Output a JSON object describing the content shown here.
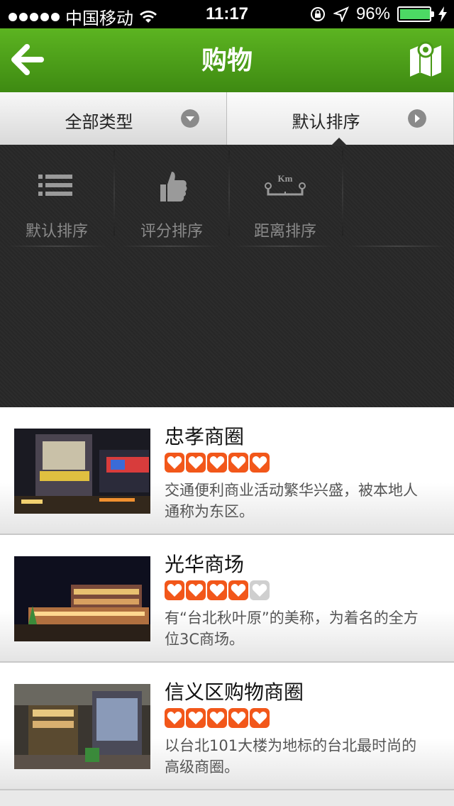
{
  "status_bar": {
    "carrier": "中国移动",
    "time": "11:17",
    "battery": "96%",
    "battery_level": 0.96
  },
  "nav": {
    "title": "购物",
    "back_icon": "arrow-left-icon",
    "map_icon": "map-pin-icon"
  },
  "filters": {
    "type_label": "全部类型",
    "sort_label": "默认排序"
  },
  "sort_options": [
    {
      "label": "默认排序",
      "icon": "list-icon"
    },
    {
      "label": "评分排序",
      "icon": "thumbs-up-icon"
    },
    {
      "label": "距离排序",
      "icon": "distance-km-icon",
      "icon_text": "Km"
    }
  ],
  "items": [
    {
      "title": "忠孝商圈",
      "rating": 5,
      "desc": "交通便利商业活动繁华兴盛，被本地人通称为东区。"
    },
    {
      "title": "光华商场",
      "rating": 4,
      "desc": "有“台北秋叶原”的美称，为着名的全方位3C商场。"
    },
    {
      "title": "信义区购物商圈",
      "rating": 5,
      "desc": "以台北101大楼为地标的台北最时尚的高级商圈。"
    }
  ],
  "colors": {
    "nav_green": "#4fa01a",
    "heart_orange": "#f2571a"
  }
}
